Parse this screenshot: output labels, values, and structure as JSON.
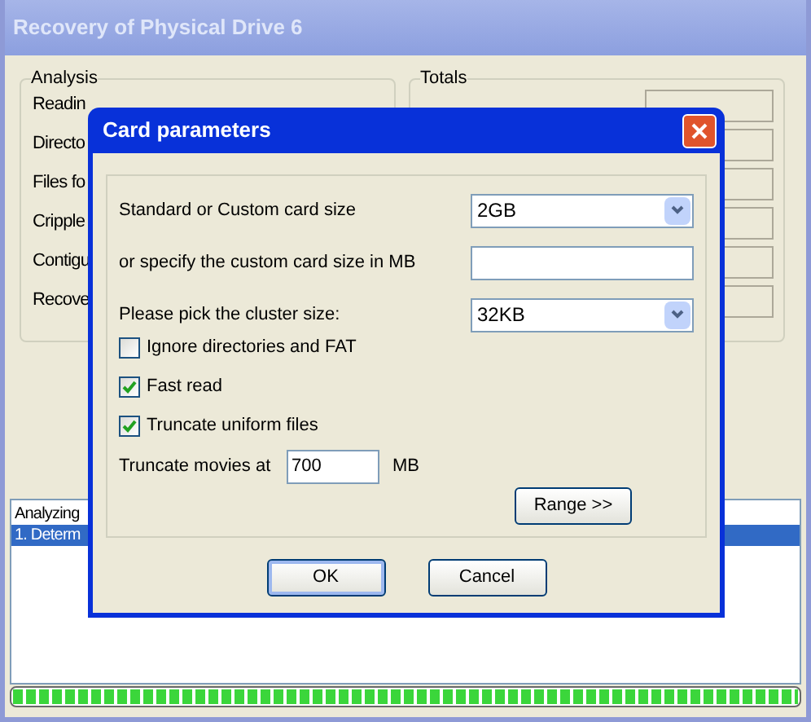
{
  "window": {
    "title": "Recovery of Physical Drive 6"
  },
  "analysis": {
    "title": "Analysis",
    "rows": [
      "Readin",
      "Directo",
      "Files fo",
      "Cripple",
      "Contigu",
      "Recove"
    ]
  },
  "totals": {
    "title": "Totals"
  },
  "log": {
    "items": [
      {
        "text": "Analyzing",
        "selected": false
      },
      {
        "text": "1. Determ",
        "selected": true
      }
    ]
  },
  "progress": {
    "level": 1
  },
  "dialog": {
    "title": "Card parameters",
    "card_size": {
      "label": "Standard or Custom card size",
      "value": "2GB"
    },
    "custom_size": {
      "label": "or specify the custom card size in MB"
    },
    "cluster": {
      "label": "Please pick the cluster size:",
      "value": "32KB"
    },
    "options": [
      {
        "label": "Ignore directories and FAT",
        "checked": false
      },
      {
        "label": "Fast read",
        "checked": true
      },
      {
        "label": "Truncate uniform files",
        "checked": true
      }
    ],
    "truncate": {
      "label": "Truncate movies at",
      "value": "700",
      "unit": "MB"
    },
    "range_button": "Range >>",
    "buttons": [
      {
        "label": "OK",
        "kind": "default"
      },
      {
        "label": "Cancel",
        "kind": "normal"
      }
    ]
  }
}
